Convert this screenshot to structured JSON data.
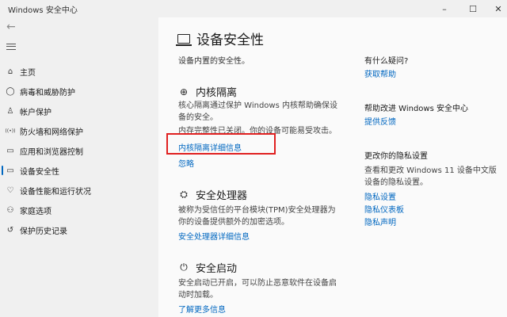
{
  "window": {
    "title": "Windows 安全中心",
    "min_glyph": "–",
    "max_glyph": "☐",
    "close_glyph": "✕"
  },
  "sidebar": {
    "back_glyph": "←",
    "items": [
      {
        "label": "主页",
        "icon": "home-icon",
        "glyph": "⌂"
      },
      {
        "label": "病毒和威胁防护",
        "icon": "shield-icon",
        "glyph": "◯"
      },
      {
        "label": "帐户保护",
        "icon": "person-icon",
        "glyph": "♙"
      },
      {
        "label": "防火墙和网络保护",
        "icon": "wifi-icon",
        "glyph": "((•))"
      },
      {
        "label": "应用和浏览器控制",
        "icon": "app-window-icon",
        "glyph": "▭"
      },
      {
        "label": "设备安全性",
        "icon": "laptop-icon",
        "glyph": "▭"
      },
      {
        "label": "设备性能和运行状况",
        "icon": "heart-icon",
        "glyph": "♡"
      },
      {
        "label": "家庭选项",
        "icon": "family-icon",
        "glyph": "⚇"
      },
      {
        "label": "保护历史记录",
        "icon": "history-icon",
        "glyph": "↺"
      }
    ]
  },
  "main": {
    "title": "设备安全性",
    "subtitle": "设备内置的安全性。",
    "core_isolation": {
      "icon_glyph": "⊕",
      "heading": "内核隔离",
      "text1": "核心隔离通过保护 Windows 内核帮助确保设备的安全。",
      "text2": "内存完整性已关闭。你的设备可能易受攻击。",
      "link_details": "内核隔离详细信息",
      "link_ignore": "忽略"
    },
    "security_processor": {
      "icon_glyph": "⛭",
      "heading": "安全处理器",
      "text": "被称为受信任的平台模块(TPM)安全处理器为你的设备提供额外的加密选项。",
      "link": "安全处理器详细信息"
    },
    "secure_boot": {
      "icon_glyph": "⏻",
      "heading": "安全启动",
      "text": "安全启动已开启，可以防止恶意软件在设备启动时加载。",
      "link": "了解更多信息"
    }
  },
  "aside": {
    "help_heading": "有什么疑问?",
    "help_link": "获取帮助",
    "improve_heading": "帮助改进 Windows 安全中心",
    "improve_link": "提供反馈",
    "privacy_heading": "更改你的隐私设置",
    "privacy_text": "查看和更改 Windows 11 设备中文版 设备的隐私设置。",
    "privacy_links": [
      "隐私设置",
      "隐私仪表板",
      "隐私声明"
    ]
  }
}
